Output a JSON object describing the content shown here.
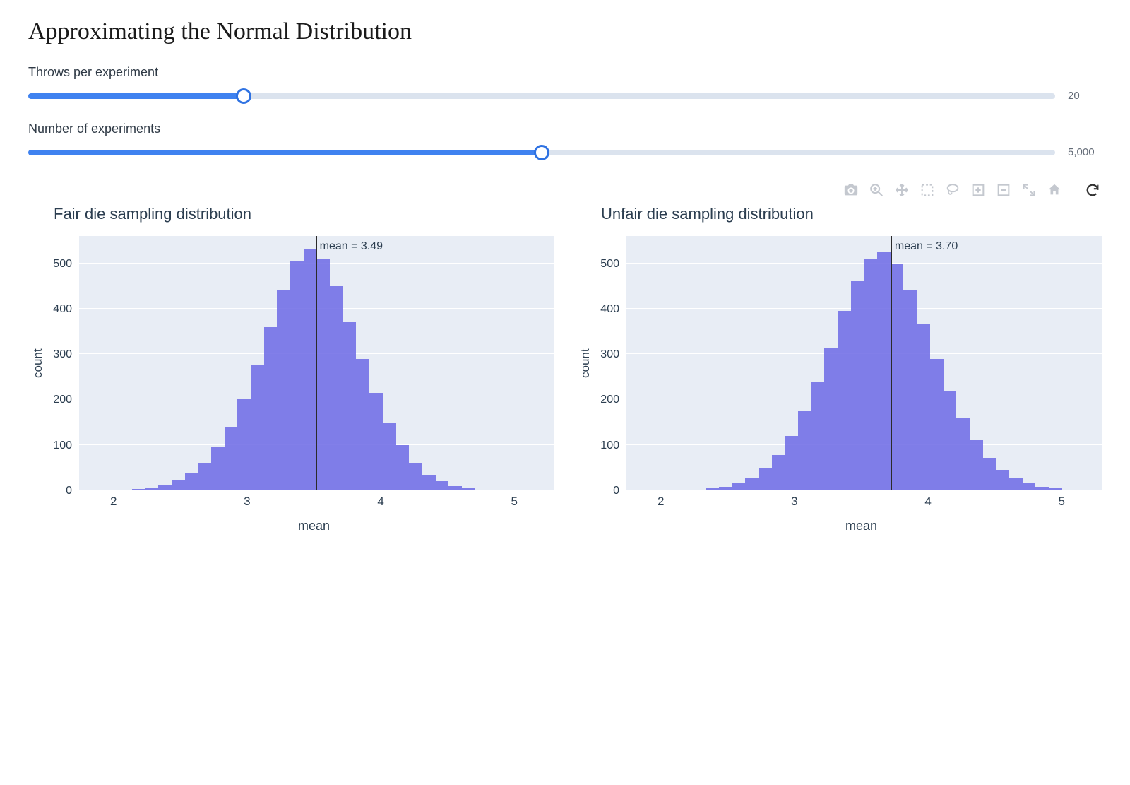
{
  "page": {
    "title": "Approximating the Normal Distribution"
  },
  "sliders": {
    "throws": {
      "label": "Throws per experiment",
      "value": 20,
      "value_display": "20",
      "percent": 21
    },
    "experiments": {
      "label": "Number of experiments",
      "value": 5000,
      "value_display": "5,000",
      "percent": 50
    }
  },
  "toolbar": {
    "icons": [
      "camera-icon",
      "zoom-in-icon",
      "pan-icon",
      "box-select-icon",
      "lasso-select-icon",
      "zoom-plus-icon",
      "zoom-minus-icon",
      "autoscale-icon",
      "reset-axes-icon",
      "refresh-icon"
    ]
  },
  "chart_data": [
    {
      "type": "bar",
      "title": "Fair die sampling distribution",
      "xlabel": "mean",
      "ylabel": "count",
      "xlim": [
        1.7,
        5.3
      ],
      "ylim": [
        0,
        560
      ],
      "xticks": [
        2,
        3,
        4,
        5
      ],
      "yticks": [
        0,
        100,
        200,
        300,
        400,
        500
      ],
      "mean_annotation": "mean = 3.49",
      "mean_x": 3.49,
      "bin_width": 0.1,
      "categories": [
        1.75,
        1.85,
        1.95,
        2.05,
        2.15,
        2.25,
        2.35,
        2.45,
        2.55,
        2.65,
        2.75,
        2.85,
        2.95,
        3.05,
        3.15,
        3.25,
        3.35,
        3.45,
        3.55,
        3.65,
        3.75,
        3.85,
        3.95,
        4.05,
        4.15,
        4.25,
        4.35,
        4.45,
        4.55,
        4.65,
        4.75,
        4.85,
        4.95,
        5.05,
        5.15,
        5.25
      ],
      "values": [
        0,
        0,
        1,
        2,
        3,
        6,
        12,
        22,
        38,
        60,
        95,
        140,
        200,
        275,
        360,
        440,
        505,
        530,
        510,
        450,
        370,
        290,
        215,
        150,
        100,
        60,
        35,
        20,
        10,
        5,
        2,
        1,
        1,
        0,
        0,
        0
      ]
    },
    {
      "type": "bar",
      "title": "Unfair die sampling distribution",
      "xlabel": "mean",
      "ylabel": "count",
      "xlim": [
        1.7,
        5.3
      ],
      "ylim": [
        0,
        560
      ],
      "xticks": [
        2,
        3,
        4,
        5
      ],
      "yticks": [
        0,
        100,
        200,
        300,
        400,
        500
      ],
      "mean_annotation": "mean = 3.70",
      "mean_x": 3.7,
      "bin_width": 0.1,
      "categories": [
        1.75,
        1.85,
        1.95,
        2.05,
        2.15,
        2.25,
        2.35,
        2.45,
        2.55,
        2.65,
        2.75,
        2.85,
        2.95,
        3.05,
        3.15,
        3.25,
        3.35,
        3.45,
        3.55,
        3.65,
        3.75,
        3.85,
        3.95,
        4.05,
        4.15,
        4.25,
        4.35,
        4.45,
        4.55,
        4.65,
        4.75,
        4.85,
        4.95,
        5.05,
        5.15,
        5.25
      ],
      "values": [
        0,
        0,
        0,
        1,
        1,
        2,
        4,
        8,
        15,
        28,
        48,
        78,
        120,
        175,
        240,
        315,
        395,
        460,
        510,
        525,
        500,
        440,
        365,
        290,
        220,
        160,
        110,
        72,
        45,
        27,
        15,
        8,
        4,
        2,
        1,
        0
      ]
    }
  ]
}
